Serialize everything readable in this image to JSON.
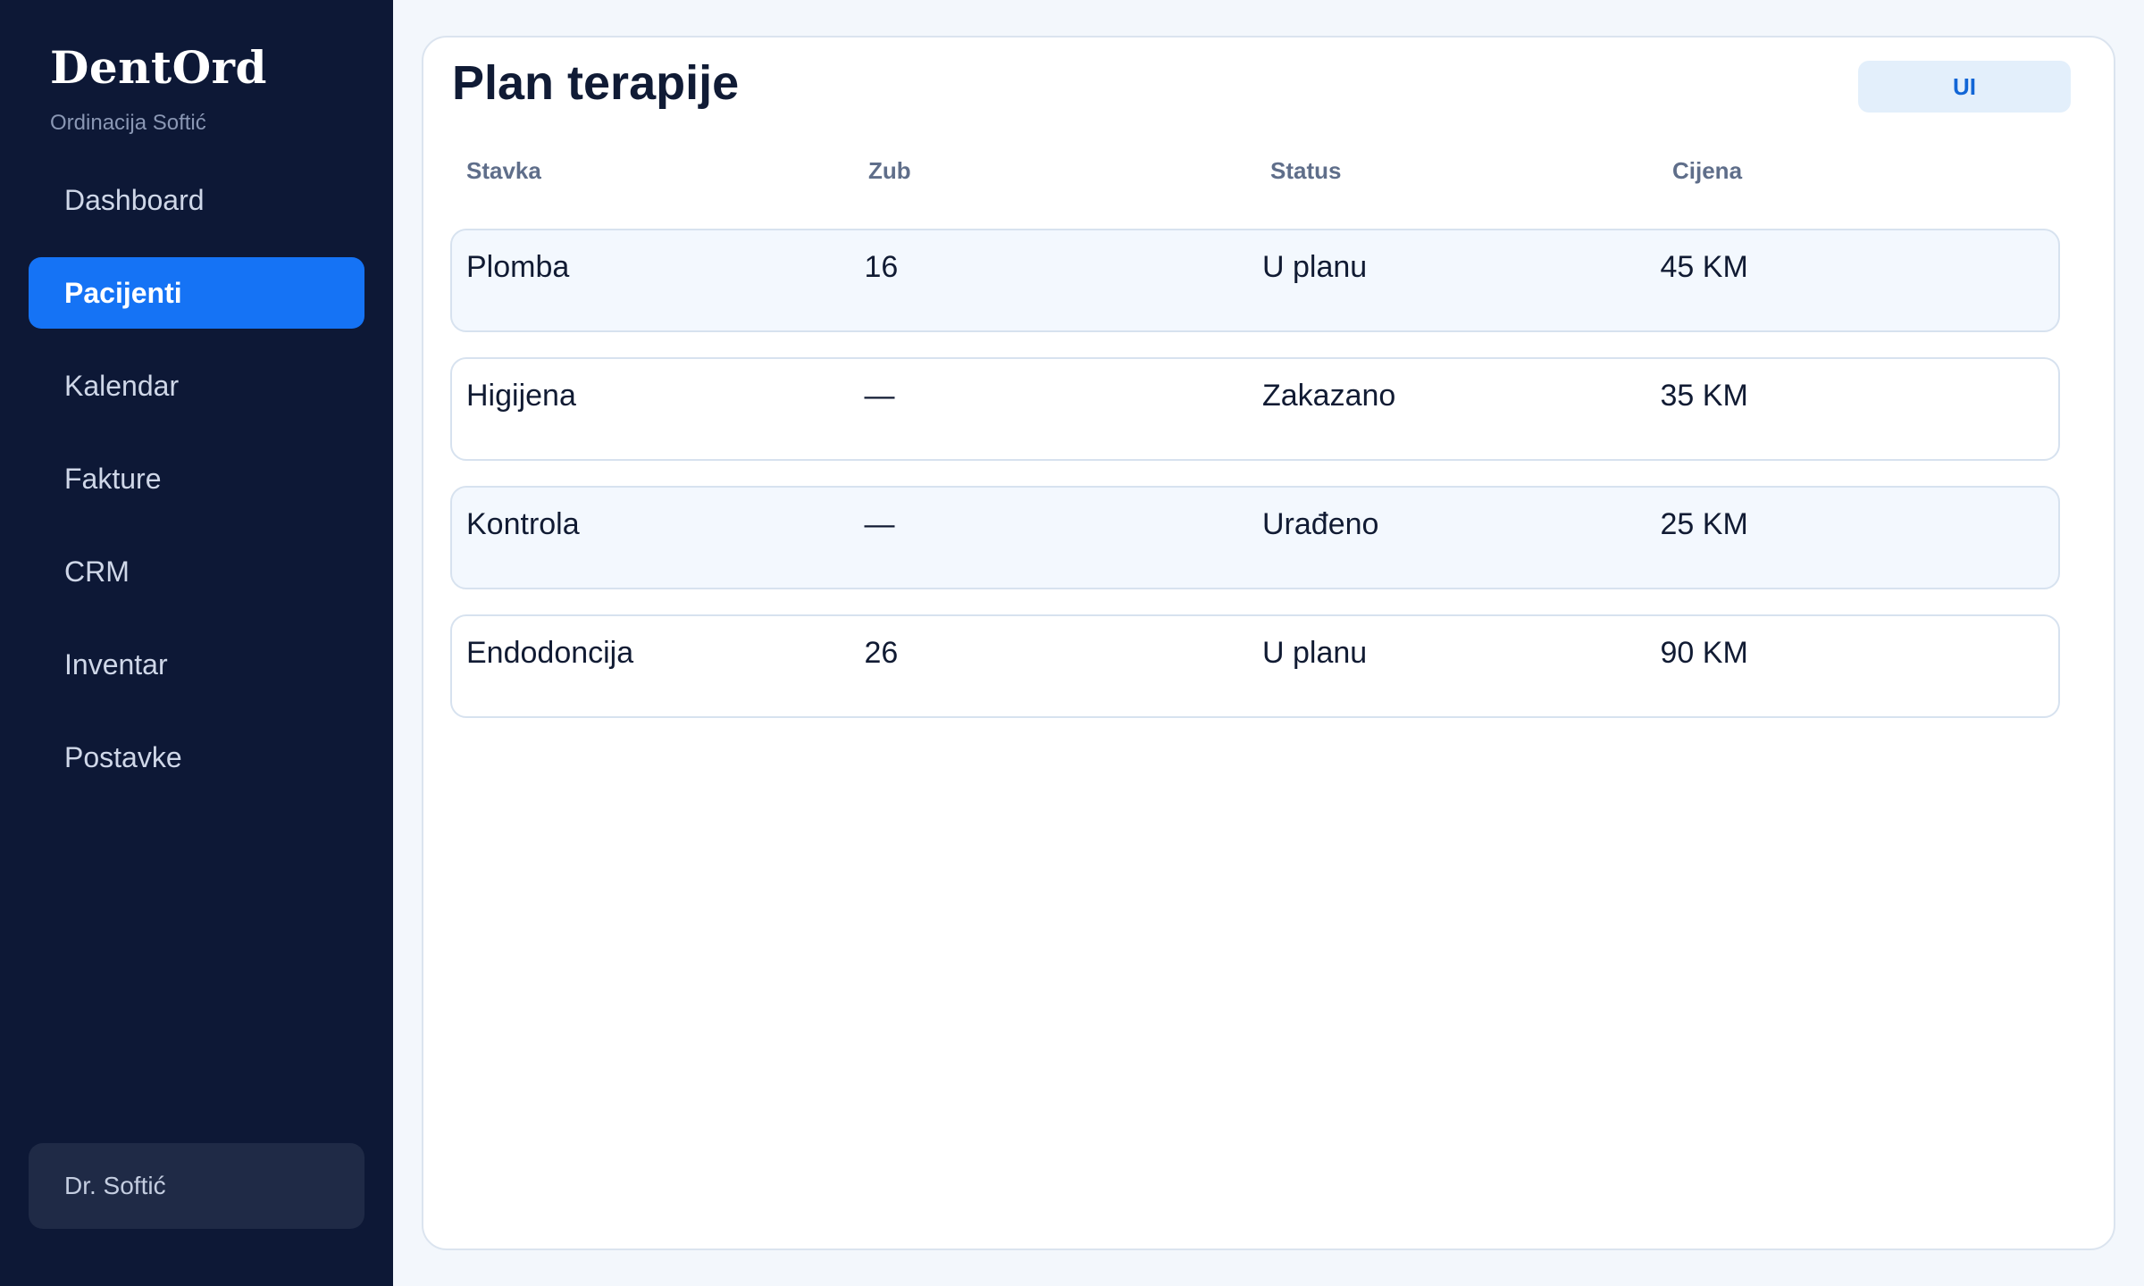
{
  "sidebar": {
    "brand": "DentOrd",
    "subtitle": "Ordinacija Softić",
    "items": [
      {
        "label": "Dashboard",
        "active": false
      },
      {
        "label": "Pacijenti",
        "active": true
      },
      {
        "label": "Kalendar",
        "active": false
      },
      {
        "label": "Fakture",
        "active": false
      },
      {
        "label": "CRM",
        "active": false
      },
      {
        "label": "Inventar",
        "active": false
      },
      {
        "label": "Postavke",
        "active": false
      }
    ],
    "user": "Dr. Softić"
  },
  "main": {
    "title": "Plan terapije",
    "action_label": "UI",
    "columns": [
      "Stavka",
      "Zub",
      "Status",
      "Cijena"
    ],
    "rows": [
      {
        "stavka": "Plomba",
        "zub": "16",
        "status": "U planu",
        "cijena": "45 KM"
      },
      {
        "stavka": "Higijena",
        "zub": "—",
        "status": "Zakazano",
        "cijena": "35 KM"
      },
      {
        "stavka": "Kontrola",
        "zub": "—",
        "status": "Urađeno",
        "cijena": "25 KM"
      },
      {
        "stavka": "Endodoncija",
        "zub": "26",
        "status": "U planu",
        "cijena": "90 KM"
      }
    ]
  },
  "colors": {
    "sidebar_bg": "#0d1836",
    "accent": "#1573f5",
    "page_bg": "#f3f7fc",
    "button_bg": "#e3effb",
    "button_text": "#1266d6"
  }
}
